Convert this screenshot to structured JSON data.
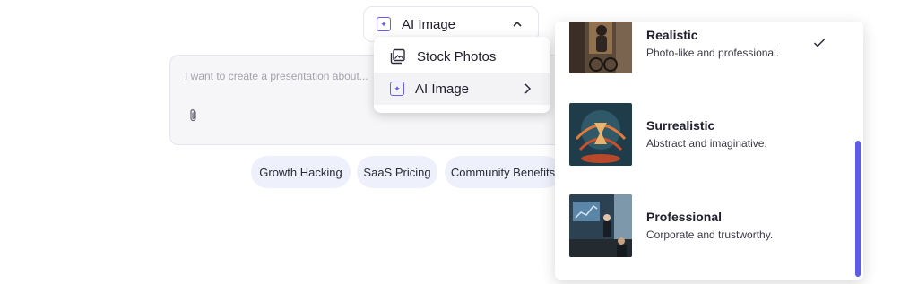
{
  "type_toggle": {
    "label": "AI Image",
    "icon": "sparkle-square-icon",
    "chevron": "chevron-up-icon"
  },
  "prompt": {
    "placeholder": "I want to create a presentation about...",
    "attach_icon": "paperclip-icon"
  },
  "suggestions": [
    "Growth Hacking",
    "SaaS Pricing",
    "Community Benefits"
  ],
  "source_menu": {
    "items": [
      {
        "label": "Stock Photos",
        "icon": "image-stack-icon"
      },
      {
        "label": "AI Image",
        "icon": "sparkle-square-icon",
        "submenu": true,
        "active": true
      }
    ]
  },
  "styles": [
    {
      "title": "Realistic",
      "desc": "Photo-like and professional.",
      "selected": true
    },
    {
      "title": "Surrealistic",
      "desc": "Abstract and imaginative.",
      "selected": false
    },
    {
      "title": "Professional",
      "desc": "Corporate and trustworthy.",
      "selected": false
    }
  ],
  "colors": {
    "accent": "#6b5cf6",
    "scrollbar": "#5b5ce8",
    "chip_bg": "#eef0fb"
  }
}
